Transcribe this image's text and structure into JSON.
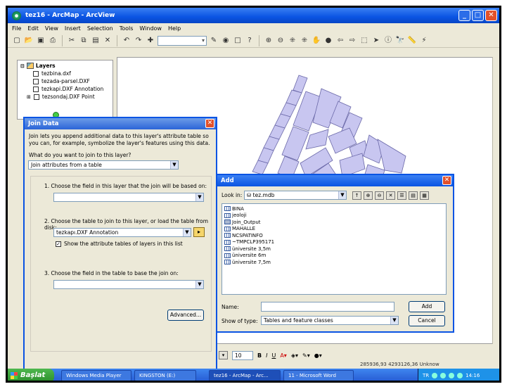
{
  "window": {
    "title": "tez16 - ArcMap - ArcView",
    "buttons": [
      "_",
      "□",
      "✕"
    ]
  },
  "menu": [
    "File",
    "Edit",
    "View",
    "Insert",
    "Selection",
    "Tools",
    "Window",
    "Help"
  ],
  "toolbar": {
    "scale_value": "",
    "icons": [
      "new-icon",
      "open-icon",
      "save-icon",
      "print-icon",
      "cut-icon",
      "copy-icon",
      "paste-icon",
      "delete-icon",
      "undo-icon",
      "redo-icon",
      "add-data-icon"
    ]
  },
  "toc": {
    "title": "Layers",
    "layers": [
      "tezbina.dxf",
      "tezada-parsel.DXF",
      "tezkapi.DXF Annotation",
      "tezsondaj.DXF Point"
    ]
  },
  "join_dialog": {
    "title": "Join Data",
    "description": "Join lets you append additional data to this layer's attribute table so you can, for example, symbolize the layer's features using this data.",
    "question": "What do you want to join to this layer?",
    "join_type": "Join attributes from a table",
    "step1": "1.  Choose the field in this layer that the join will be based on:",
    "step1_value": "",
    "step2": "2.  Choose the table to join to this layer, or load the table from disk:",
    "step2_value": "tezkapı.DXF Annotation",
    "show_attr": "Show the attribute tables of layers in this list",
    "step3": "3.  Choose the field in the table to base the join on:",
    "step3_value": "",
    "advanced": "Advanced..."
  },
  "add_dialog": {
    "title": "Add",
    "look_in_label": "Look in:",
    "look_in_value": "tez.mdb",
    "files": [
      {
        "name": "BINA",
        "type": "table"
      },
      {
        "name": "jeoloji",
        "type": "table"
      },
      {
        "name": "Join_Output",
        "type": "raster"
      },
      {
        "name": "MAHALLE",
        "type": "table"
      },
      {
        "name": "NCSPATINFO",
        "type": "table"
      },
      {
        "name": "~TMPCLP395171",
        "type": "table"
      },
      {
        "name": "üniversite 3,5m",
        "type": "table"
      },
      {
        "name": "üniversite 6m",
        "type": "table"
      },
      {
        "name": "üniversite 7,5m",
        "type": "table"
      }
    ],
    "name_label": "Name:",
    "name_value": "",
    "type_label": "Show of type:",
    "type_value": "Tables and feature classes",
    "add_btn": "Add",
    "cancel_btn": "Cancel"
  },
  "drawbar": {
    "font_size": "10",
    "bold": "B",
    "italic": "I",
    "underline": "U"
  },
  "status": "285936,93  4293126,36 Unknow",
  "taskbar": {
    "start": "Başlat",
    "tasks": [
      "Windows Media Player",
      "KINGSTON (E:)",
      "tez16 - ArcMap - Arc...",
      "11 - Microsoft Word"
    ],
    "lang": "TR",
    "clock": "14:16"
  }
}
